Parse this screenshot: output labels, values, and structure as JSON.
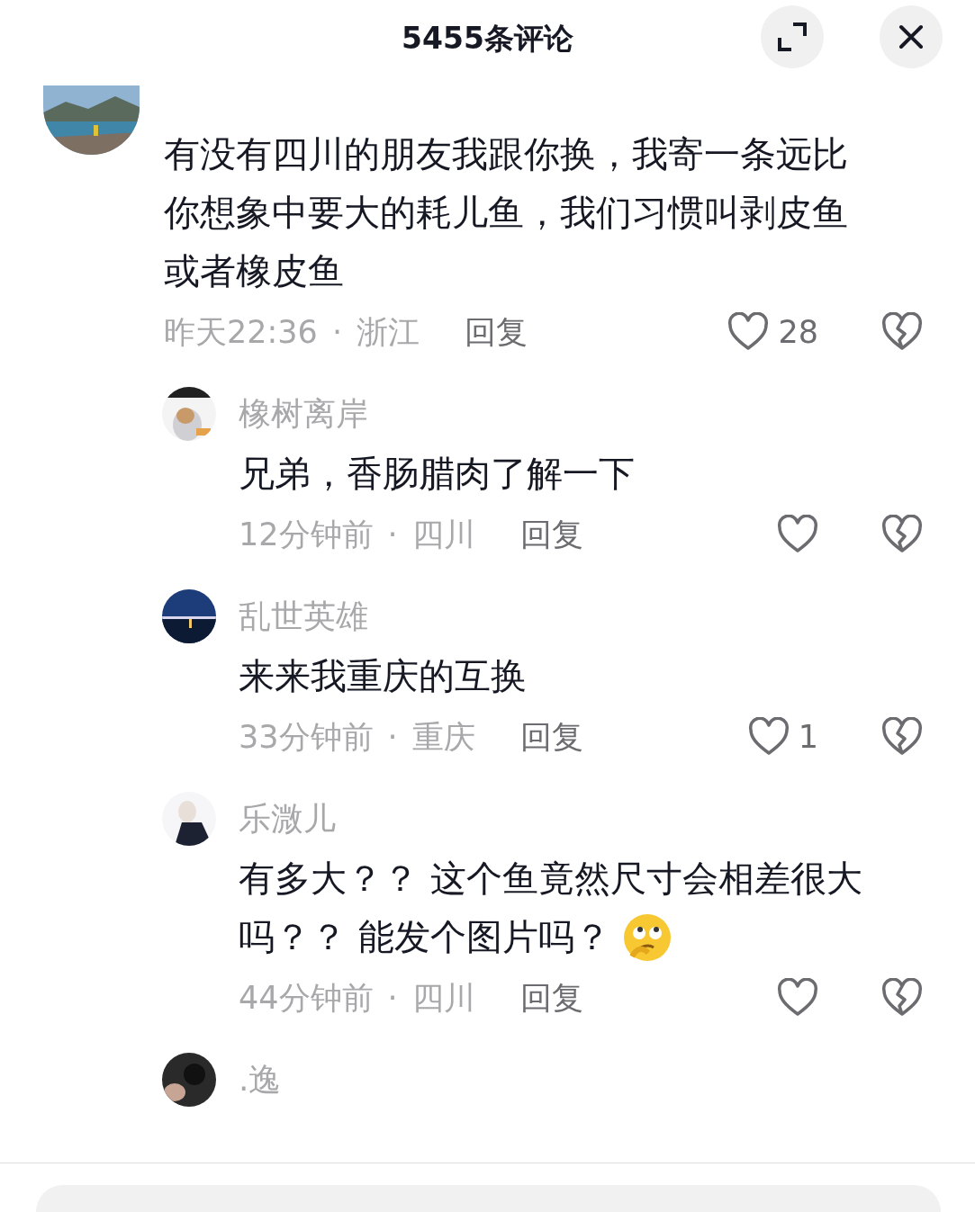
{
  "header": {
    "title": "5455条评论"
  },
  "comments": [
    {
      "kind": "comment",
      "lines": [
        "有没有四川的朋友我跟你换，我寄一条远比",
        "你想象中要大的耗儿鱼，我们习惯叫剥皮鱼",
        "或者橡皮鱼"
      ],
      "time": "昨天22:36",
      "separator": "·",
      "region": "浙江",
      "reply": "回复",
      "likes": "28"
    },
    {
      "kind": "reply",
      "name": "橡树离岸",
      "lines": [
        "兄弟，香肠腊肉了解一下"
      ],
      "time": "12分钟前",
      "separator": "·",
      "region": "四川",
      "reply": "回复"
    },
    {
      "kind": "reply",
      "name": "乱世英雄",
      "lines": [
        "来来我重庆的互换"
      ],
      "time": "33分钟前",
      "separator": "·",
      "region": "重庆",
      "reply": "回复",
      "likes": "1"
    },
    {
      "kind": "reply",
      "name": "乐溦儿",
      "lines": [
        "有多大？？ 这个鱼竟然尺寸会相差很大",
        "吗？？ 能发个图片吗？"
      ],
      "emoji": true,
      "time": "44分钟前",
      "separator": "·",
      "region": "四川",
      "reply": "回复"
    },
    {
      "kind": "reply",
      "name": ".逸"
    }
  ]
}
